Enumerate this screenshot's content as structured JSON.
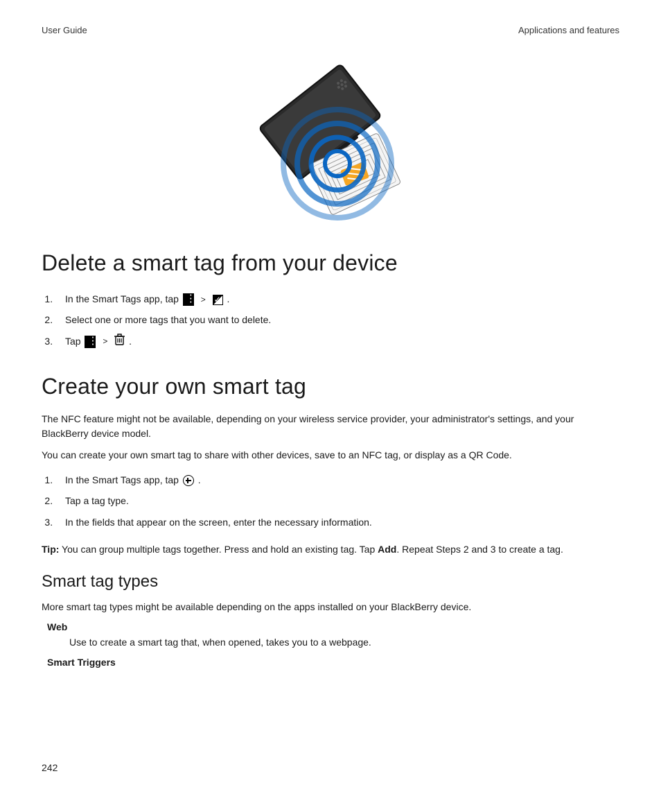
{
  "header": {
    "left": "User Guide",
    "right": "Applications and features"
  },
  "section1": {
    "title": "Delete a smart tag from your device",
    "steps": {
      "s1a": "In the Smart Tags app, tap ",
      "s1b": " .",
      "s2": "Select one or more tags that you want to delete.",
      "s3a": "Tap ",
      "s3b": " ."
    }
  },
  "section2": {
    "title": "Create your own smart tag",
    "p1": "The NFC feature might not be available, depending on your wireless service provider, your administrator's settings, and your BlackBerry device model.",
    "p2": "You can create your own smart tag to share with other devices, save to an NFC tag, or display as a QR Code.",
    "steps": {
      "s1a": "In the Smart Tags app, tap ",
      "s1b": " .",
      "s2": "Tap a tag type.",
      "s3": "In the fields that appear on the screen, enter the necessary information."
    },
    "tipLabel": "Tip:",
    "tipA": " You can group multiple tags together. Press and hold an existing tag. Tap ",
    "tipAdd": "Add",
    "tipB": ". Repeat Steps 2 and 3 to create a tag."
  },
  "section3": {
    "title": "Smart tag types",
    "p1": "More smart tag types might be available depending on the apps installed on your BlackBerry device.",
    "items": {
      "web": {
        "term": "Web",
        "def": "Use to create a smart tag that, when opened, takes you to a webpage."
      },
      "triggers": {
        "term": "Smart Triggers"
      }
    }
  },
  "sep": ">",
  "pageNumber": "242"
}
